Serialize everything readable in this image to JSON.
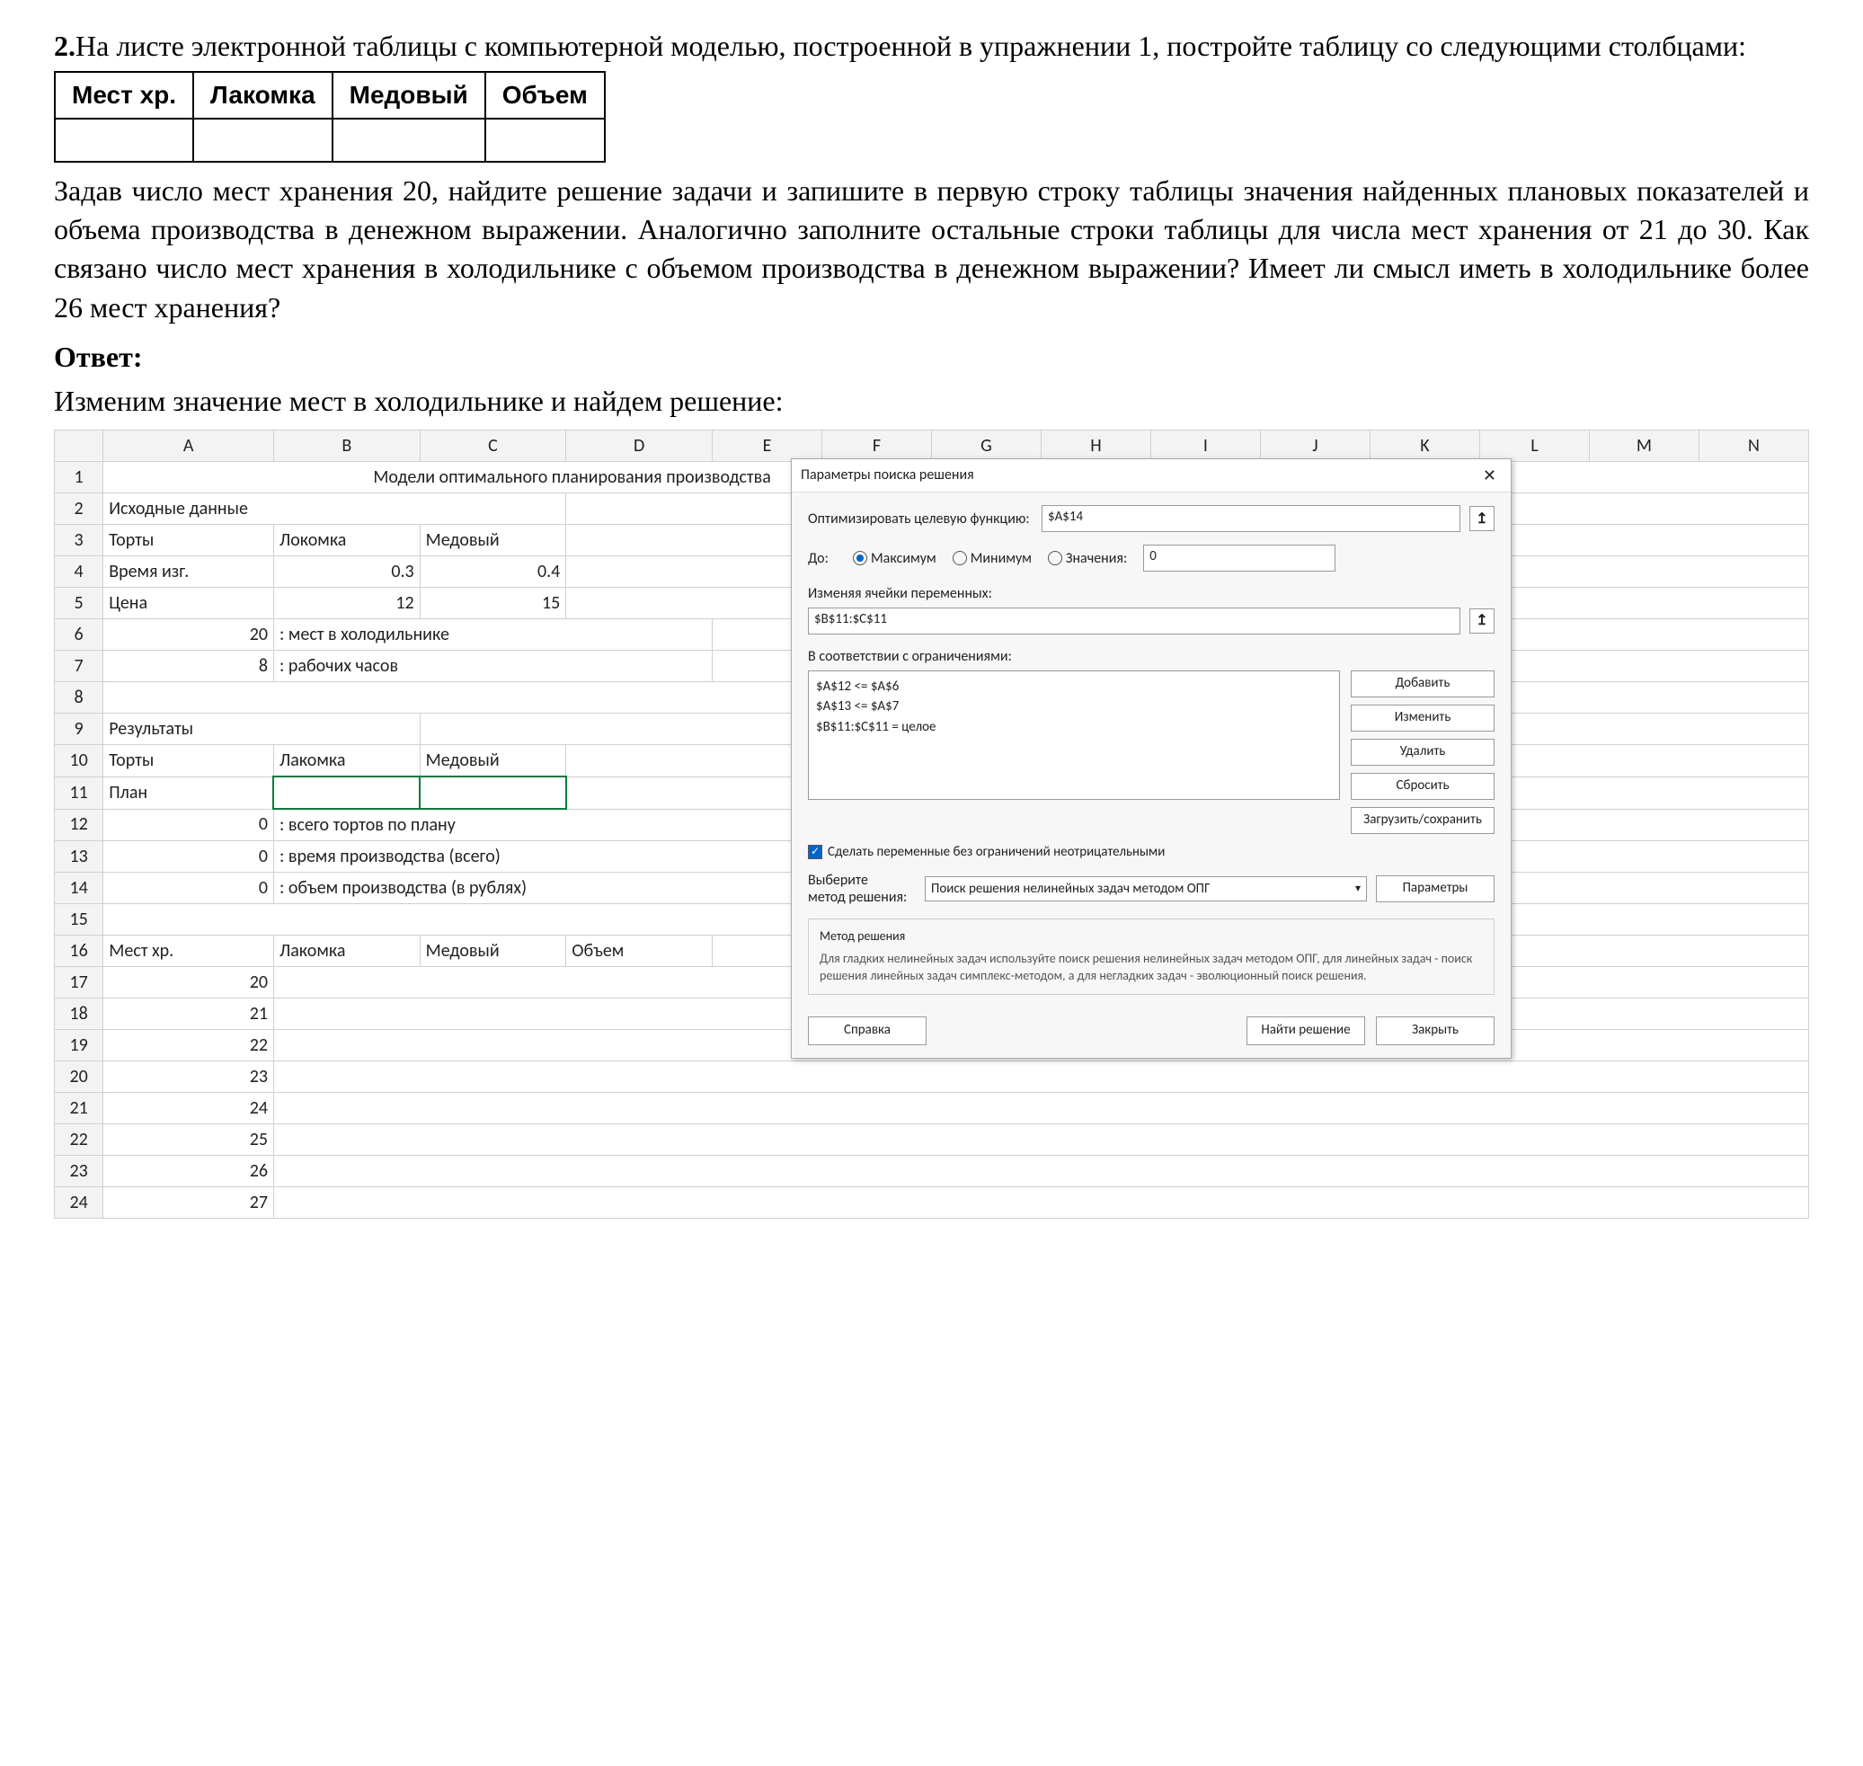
{
  "prompt": {
    "number": "2.",
    "para1_a": "На листе электронной таблицы с компьютерной моделью, построенной в упражнении 1, постройте таблицу со следующими столбцами:",
    "header_cols": [
      "Мест хр.",
      "Лакомка",
      "Медовый",
      "Объем"
    ],
    "para2": "Задав число мест хранения 20, найдите решение задачи и запишите в первую строку таблицы значения найденных плановых показателей и объема производства в денежном выражении. Аналогично заполните остальные строки таблицы для числа мест хранения от 21 до 30. Как связано число мест хранения в холодильнике с объемом производства в денежном выражении? Имеет ли смысл иметь в холодильнике более 26 мест хранения?",
    "answer_label": "Ответ:",
    "answer_text": "Изменим значение мест в холодильнике и найдем решение:"
  },
  "sheet": {
    "col_headers": [
      "",
      "A",
      "B",
      "C",
      "D",
      "E",
      "F",
      "G",
      "H",
      "I",
      "J",
      "K",
      "L",
      "M",
      "N"
    ],
    "r1_title": "Модели оптимального планирования производства",
    "r2_A": "Исходные данные",
    "r3": {
      "A": "Торты",
      "B": "Локомка",
      "C": "Медовый"
    },
    "r4": {
      "A": "Время изг.",
      "B": "0.3",
      "C": "0.4"
    },
    "r5": {
      "A": "Цена",
      "B": "12",
      "C": "15"
    },
    "r6": {
      "A": "20",
      "B": ": мест в холодильнике"
    },
    "r7": {
      "A": "8",
      "B": ": рабочих часов"
    },
    "r9_A": "Результаты",
    "r10": {
      "A": "Торты",
      "B": "Лакомка",
      "C": "Медовый"
    },
    "r11_A": "План",
    "r12": {
      "A": "0",
      "B": ": всего тортов по плану"
    },
    "r13": {
      "A": "0",
      "B": ": время производства (всего)"
    },
    "r14": {
      "A": "0",
      "B": ": объем производства (в рублях)"
    },
    "r16": {
      "A": "Мест хр.",
      "B": "Лакомка",
      "C": "Медовый",
      "D": "Объем"
    },
    "r17_A": "20",
    "r18_A": "21",
    "r19_A": "22",
    "r20_A": "23",
    "r21_A": "24",
    "r22_A": "25",
    "r23_A": "26",
    "r24_A": "27"
  },
  "dialog": {
    "title": "Параметры поиска решения",
    "obj_label": "Оптимизировать целевую функцию:",
    "obj_value": "$A$14",
    "to_label": "До:",
    "radio_max": "Максимум",
    "radio_min": "Минимум",
    "radio_val": "Значения:",
    "value_input": "0",
    "vars_label": "Изменяя ячейки переменных:",
    "vars_value": "$B$11:$C$11",
    "constraints_label": "В соответствии с ограничениями:",
    "constraints": [
      "$A$12 <= $A$6",
      "$A$13 <= $A$7",
      "$B$11:$C$11 = целое"
    ],
    "btn_add": "Добавить",
    "btn_edit": "Изменить",
    "btn_delete": "Удалить",
    "btn_reset": "Сбросить",
    "btn_loadsave": "Загрузить/сохранить",
    "nonneg_label": "Сделать переменные без ограничений неотрицательными",
    "method_label_a": "Выберите",
    "method_label_b": "метод решения:",
    "method_value": "Поиск решения нелинейных задач методом ОПГ",
    "btn_params": "Параметры",
    "help_title": "Метод решения",
    "help_text": "Для гладких нелинейных задач используйте поиск решения нелинейных задач методом ОПГ, для линейных задач - поиск решения линейных задач симплекс-методом, а для негладких задач - эволюционный поиск решения.",
    "btn_help": "Справка",
    "btn_solve": "Найти решение",
    "btn_close": "Закрыть"
  }
}
